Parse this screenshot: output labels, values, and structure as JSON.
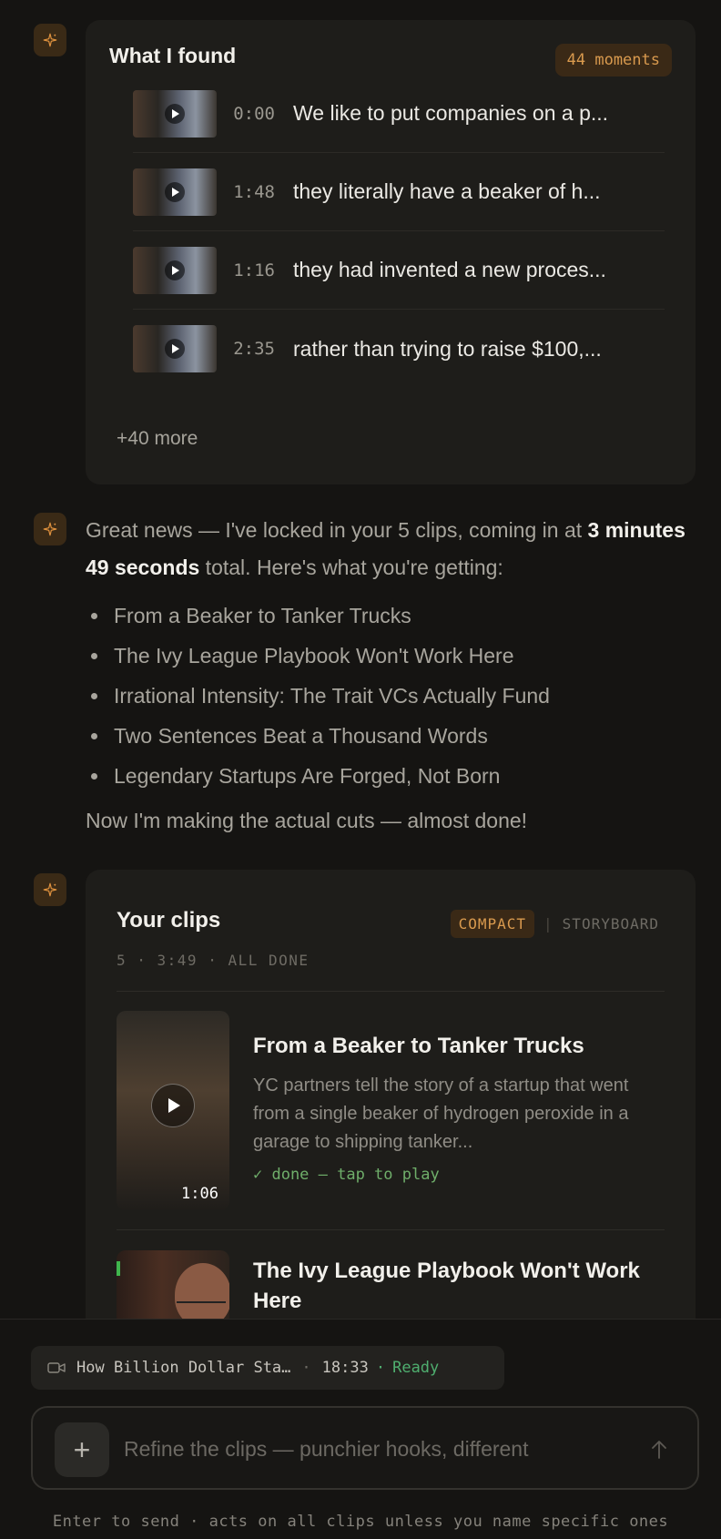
{
  "found": {
    "title": "What I found",
    "count_badge": "44 moments",
    "moments": [
      {
        "time": "0:00",
        "text": "We like to put companies on a p..."
      },
      {
        "time": "1:48",
        "text": "they literally have a beaker of h..."
      },
      {
        "time": "1:16",
        "text": "they had invented a new proces..."
      },
      {
        "time": "2:35",
        "text": "rather than trying to raise $100,..."
      }
    ],
    "more": "+40 more"
  },
  "message": {
    "intro_a": "Great news — I've locked in your 5 clips, coming in at ",
    "intro_bold": "3 minutes 49 seconds",
    "intro_b": " total. Here's what you're getting:",
    "bullets": [
      "From a Beaker to Tanker Trucks",
      "The Ivy League Playbook Won't Work Here",
      "Irrational Intensity: The Trait VCs Actually Fund",
      "Two Sentences Beat a Thousand Words",
      "Legendary Startups Are Forged, Not Born"
    ],
    "outro": "Now I'm making the actual cuts — almost done!"
  },
  "clips": {
    "title": "Your clips",
    "view_active": "COMPACT",
    "view_sep": "|",
    "view_inactive": "STORYBOARD",
    "meta": "5 · 3:49 · ALL DONE",
    "items": [
      {
        "title": "From a Beaker to Tanker Trucks",
        "description": "YC partners tell the story of a startup that went from a single beaker of hydrogen peroxide in a garage to shipping tanker...",
        "status": "✓ done — tap to play",
        "duration": "1:06"
      },
      {
        "title": "The Ivy League Playbook Won't Work Here"
      }
    ]
  },
  "source": {
    "name": "How Billion Dollar Sta…",
    "sep": "·",
    "duration": "18:33",
    "status": "Ready"
  },
  "composer": {
    "placeholder": "Refine the clips — punchier hooks, different",
    "add_label": "+",
    "hint": "Enter to send · acts on all clips unless you name specific ones"
  },
  "colors": {
    "accent": "#d99a4e",
    "ready": "#4fae6f",
    "done": "#6fae6a",
    "background": "#151412",
    "card": "#1e1d1a"
  }
}
